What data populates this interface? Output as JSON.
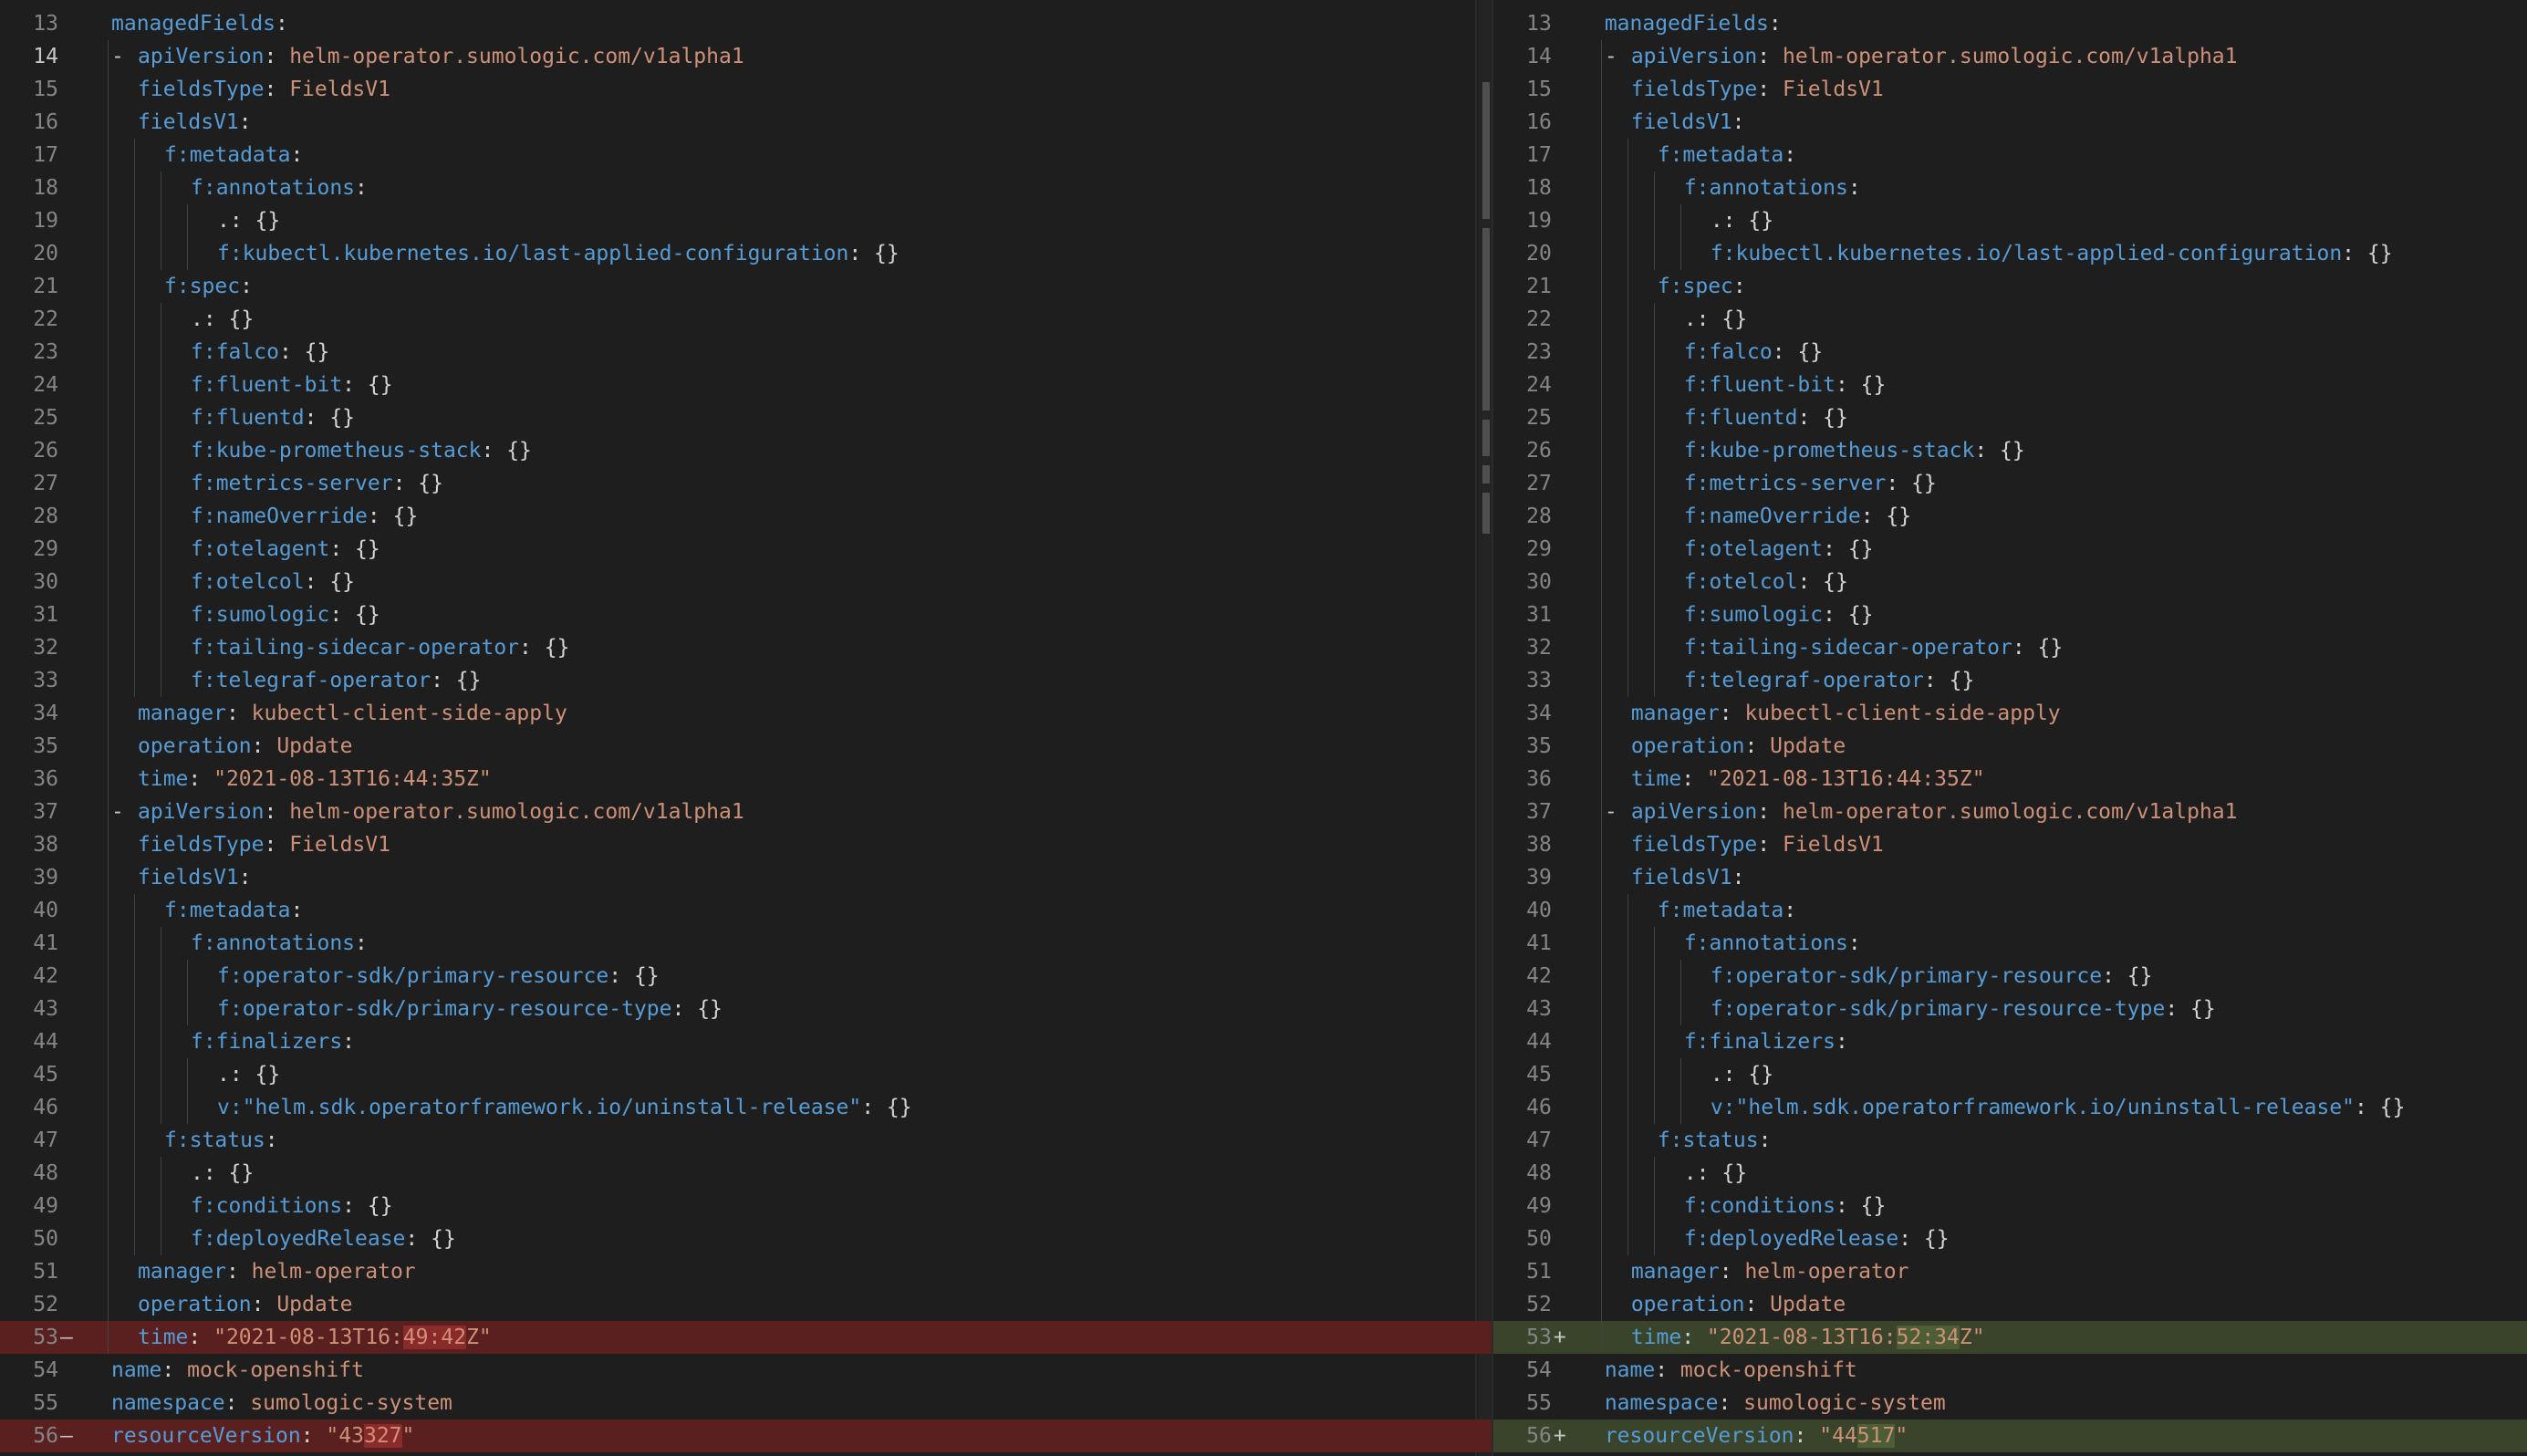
{
  "colors": {
    "removed_bg": "#5a1f1f",
    "added_bg": "#39442a",
    "key": "#569cd6",
    "string": "#ce9178"
  },
  "left": {
    "lines": [
      {
        "n": "13",
        "m": "",
        "fold": "",
        "indent": 0,
        "k": "managedFields",
        "sep": ":",
        "v": ""
      },
      {
        "n": "14",
        "m": "",
        "fold": "-",
        "indent": 1,
        "k": "apiVersion",
        "sep": ": ",
        "v": "helm-operator.sumologic.com/v1alpha1",
        "cur": true
      },
      {
        "n": "15",
        "m": "",
        "fold": "",
        "indent": 1,
        "k": "fieldsType",
        "sep": ": ",
        "v": "FieldsV1"
      },
      {
        "n": "16",
        "m": "",
        "fold": "",
        "indent": 1,
        "k": "fieldsV1",
        "sep": ":",
        "v": ""
      },
      {
        "n": "17",
        "m": "",
        "fold": "",
        "indent": 2,
        "k": "f:metadata",
        "sep": ":",
        "v": ""
      },
      {
        "n": "18",
        "m": "",
        "fold": "",
        "indent": 3,
        "k": "f:annotations",
        "sep": ":",
        "v": ""
      },
      {
        "n": "19",
        "m": "",
        "fold": "",
        "indent": 4,
        "k": "",
        "sep": ".: {}",
        "v": ""
      },
      {
        "n": "20",
        "m": "",
        "fold": "",
        "indent": 4,
        "k": "f:kubectl.kubernetes.io/last-applied-configuration",
        "sep": ": {}",
        "v": ""
      },
      {
        "n": "21",
        "m": "",
        "fold": "",
        "indent": 2,
        "k": "f:spec",
        "sep": ":",
        "v": ""
      },
      {
        "n": "22",
        "m": "",
        "fold": "",
        "indent": 3,
        "k": "",
        "sep": ".: {}",
        "v": ""
      },
      {
        "n": "23",
        "m": "",
        "fold": "",
        "indent": 3,
        "k": "f:falco",
        "sep": ": {}",
        "v": ""
      },
      {
        "n": "24",
        "m": "",
        "fold": "",
        "indent": 3,
        "k": "f:fluent-bit",
        "sep": ": {}",
        "v": ""
      },
      {
        "n": "25",
        "m": "",
        "fold": "",
        "indent": 3,
        "k": "f:fluentd",
        "sep": ": {}",
        "v": ""
      },
      {
        "n": "26",
        "m": "",
        "fold": "",
        "indent": 3,
        "k": "f:kube-prometheus-stack",
        "sep": ": {}",
        "v": ""
      },
      {
        "n": "27",
        "m": "",
        "fold": "",
        "indent": 3,
        "k": "f:metrics-server",
        "sep": ": {}",
        "v": ""
      },
      {
        "n": "28",
        "m": "",
        "fold": "",
        "indent": 3,
        "k": "f:nameOverride",
        "sep": ": {}",
        "v": ""
      },
      {
        "n": "29",
        "m": "",
        "fold": "",
        "indent": 3,
        "k": "f:otelagent",
        "sep": ": {}",
        "v": ""
      },
      {
        "n": "30",
        "m": "",
        "fold": "",
        "indent": 3,
        "k": "f:otelcol",
        "sep": ": {}",
        "v": ""
      },
      {
        "n": "31",
        "m": "",
        "fold": "",
        "indent": 3,
        "k": "f:sumologic",
        "sep": ": {}",
        "v": ""
      },
      {
        "n": "32",
        "m": "",
        "fold": "",
        "indent": 3,
        "k": "f:tailing-sidecar-operator",
        "sep": ": {}",
        "v": ""
      },
      {
        "n": "33",
        "m": "",
        "fold": "",
        "indent": 3,
        "k": "f:telegraf-operator",
        "sep": ": {}",
        "v": ""
      },
      {
        "n": "34",
        "m": "",
        "fold": "",
        "indent": 1,
        "k": "manager",
        "sep": ": ",
        "v": "kubectl-client-side-apply"
      },
      {
        "n": "35",
        "m": "",
        "fold": "",
        "indent": 1,
        "k": "operation",
        "sep": ": ",
        "v": "Update"
      },
      {
        "n": "36",
        "m": "",
        "fold": "",
        "indent": 1,
        "k": "time",
        "sep": ": ",
        "v": "\"2021-08-13T16:44:35Z\""
      },
      {
        "n": "37",
        "m": "",
        "fold": "-",
        "indent": 1,
        "k": "apiVersion",
        "sep": ": ",
        "v": "helm-operator.sumologic.com/v1alpha1"
      },
      {
        "n": "38",
        "m": "",
        "fold": "",
        "indent": 1,
        "k": "fieldsType",
        "sep": ": ",
        "v": "FieldsV1"
      },
      {
        "n": "39",
        "m": "",
        "fold": "",
        "indent": 1,
        "k": "fieldsV1",
        "sep": ":",
        "v": ""
      },
      {
        "n": "40",
        "m": "",
        "fold": "",
        "indent": 2,
        "k": "f:metadata",
        "sep": ":",
        "v": ""
      },
      {
        "n": "41",
        "m": "",
        "fold": "",
        "indent": 3,
        "k": "f:annotations",
        "sep": ":",
        "v": ""
      },
      {
        "n": "42",
        "m": "",
        "fold": "",
        "indent": 4,
        "k": "f:operator-sdk/primary-resource",
        "sep": ": {}",
        "v": ""
      },
      {
        "n": "43",
        "m": "",
        "fold": "",
        "indent": 4,
        "k": "f:operator-sdk/primary-resource-type",
        "sep": ": {}",
        "v": ""
      },
      {
        "n": "44",
        "m": "",
        "fold": "",
        "indent": 3,
        "k": "f:finalizers",
        "sep": ":",
        "v": ""
      },
      {
        "n": "45",
        "m": "",
        "fold": "",
        "indent": 4,
        "k": "",
        "sep": ".: {}",
        "v": ""
      },
      {
        "n": "46",
        "m": "",
        "fold": "",
        "indent": 4,
        "k": "v:\"helm.sdk.operatorframework.io/uninstall-release\"",
        "sep": ": {}",
        "v": ""
      },
      {
        "n": "47",
        "m": "",
        "fold": "",
        "indent": 2,
        "k": "f:status",
        "sep": ":",
        "v": ""
      },
      {
        "n": "48",
        "m": "",
        "fold": "",
        "indent": 3,
        "k": "",
        "sep": ".: {}",
        "v": ""
      },
      {
        "n": "49",
        "m": "",
        "fold": "",
        "indent": 3,
        "k": "f:conditions",
        "sep": ": {}",
        "v": ""
      },
      {
        "n": "50",
        "m": "",
        "fold": "",
        "indent": 3,
        "k": "f:deployedRelease",
        "sep": ": {}",
        "v": ""
      },
      {
        "n": "51",
        "m": "",
        "fold": "",
        "indent": 1,
        "k": "manager",
        "sep": ": ",
        "v": "helm-operator"
      },
      {
        "n": "52",
        "m": "",
        "fold": "",
        "indent": 1,
        "k": "operation",
        "sep": ": ",
        "v": "Update"
      },
      {
        "n": "53",
        "m": "—",
        "fold": "",
        "indent": 1,
        "k": "time",
        "sep": ": ",
        "v": "\"2021-08-13T16:",
        "vh": "49:42",
        "v2": "Z\"",
        "type": "removed"
      },
      {
        "n": "54",
        "m": "",
        "fold": "",
        "indent": 0,
        "k": "name",
        "sep": ": ",
        "v": "mock-openshift"
      },
      {
        "n": "55",
        "m": "",
        "fold": "",
        "indent": 0,
        "k": "namespace",
        "sep": ": ",
        "v": "sumologic-system"
      },
      {
        "n": "56",
        "m": "—",
        "fold": "",
        "indent": 0,
        "k": "resourceVersion",
        "sep": ": ",
        "v": "\"43",
        "vh": "327",
        "v2": "\"",
        "type": "removed"
      }
    ]
  },
  "right": {
    "lines": [
      {
        "n": "13",
        "m": "",
        "fold": "",
        "indent": 0,
        "k": "managedFields",
        "sep": ":",
        "v": ""
      },
      {
        "n": "14",
        "m": "",
        "fold": "-",
        "indent": 1,
        "k": "apiVersion",
        "sep": ": ",
        "v": "helm-operator.sumologic.com/v1alpha1"
      },
      {
        "n": "15",
        "m": "",
        "fold": "",
        "indent": 1,
        "k": "fieldsType",
        "sep": ": ",
        "v": "FieldsV1"
      },
      {
        "n": "16",
        "m": "",
        "fold": "",
        "indent": 1,
        "k": "fieldsV1",
        "sep": ":",
        "v": ""
      },
      {
        "n": "17",
        "m": "",
        "fold": "",
        "indent": 2,
        "k": "f:metadata",
        "sep": ":",
        "v": ""
      },
      {
        "n": "18",
        "m": "",
        "fold": "",
        "indent": 3,
        "k": "f:annotations",
        "sep": ":",
        "v": ""
      },
      {
        "n": "19",
        "m": "",
        "fold": "",
        "indent": 4,
        "k": "",
        "sep": ".: {}",
        "v": ""
      },
      {
        "n": "20",
        "m": "",
        "fold": "",
        "indent": 4,
        "k": "f:kubectl.kubernetes.io/last-applied-configuration",
        "sep": ": {}",
        "v": ""
      },
      {
        "n": "21",
        "m": "",
        "fold": "",
        "indent": 2,
        "k": "f:spec",
        "sep": ":",
        "v": ""
      },
      {
        "n": "22",
        "m": "",
        "fold": "",
        "indent": 3,
        "k": "",
        "sep": ".: {}",
        "v": ""
      },
      {
        "n": "23",
        "m": "",
        "fold": "",
        "indent": 3,
        "k": "f:falco",
        "sep": ": {}",
        "v": ""
      },
      {
        "n": "24",
        "m": "",
        "fold": "",
        "indent": 3,
        "k": "f:fluent-bit",
        "sep": ": {}",
        "v": ""
      },
      {
        "n": "25",
        "m": "",
        "fold": "",
        "indent": 3,
        "k": "f:fluentd",
        "sep": ": {}",
        "v": ""
      },
      {
        "n": "26",
        "m": "",
        "fold": "",
        "indent": 3,
        "k": "f:kube-prometheus-stack",
        "sep": ": {}",
        "v": ""
      },
      {
        "n": "27",
        "m": "",
        "fold": "",
        "indent": 3,
        "k": "f:metrics-server",
        "sep": ": {}",
        "v": ""
      },
      {
        "n": "28",
        "m": "",
        "fold": "",
        "indent": 3,
        "k": "f:nameOverride",
        "sep": ": {}",
        "v": ""
      },
      {
        "n": "29",
        "m": "",
        "fold": "",
        "indent": 3,
        "k": "f:otelagent",
        "sep": ": {}",
        "v": ""
      },
      {
        "n": "30",
        "m": "",
        "fold": "",
        "indent": 3,
        "k": "f:otelcol",
        "sep": ": {}",
        "v": ""
      },
      {
        "n": "31",
        "m": "",
        "fold": "",
        "indent": 3,
        "k": "f:sumologic",
        "sep": ": {}",
        "v": ""
      },
      {
        "n": "32",
        "m": "",
        "fold": "",
        "indent": 3,
        "k": "f:tailing-sidecar-operator",
        "sep": ": {}",
        "v": ""
      },
      {
        "n": "33",
        "m": "",
        "fold": "",
        "indent": 3,
        "k": "f:telegraf-operator",
        "sep": ": {}",
        "v": ""
      },
      {
        "n": "34",
        "m": "",
        "fold": "",
        "indent": 1,
        "k": "manager",
        "sep": ": ",
        "v": "kubectl-client-side-apply"
      },
      {
        "n": "35",
        "m": "",
        "fold": "",
        "indent": 1,
        "k": "operation",
        "sep": ": ",
        "v": "Update"
      },
      {
        "n": "36",
        "m": "",
        "fold": "",
        "indent": 1,
        "k": "time",
        "sep": ": ",
        "v": "\"2021-08-13T16:44:35Z\""
      },
      {
        "n": "37",
        "m": "",
        "fold": "-",
        "indent": 1,
        "k": "apiVersion",
        "sep": ": ",
        "v": "helm-operator.sumologic.com/v1alpha1"
      },
      {
        "n": "38",
        "m": "",
        "fold": "",
        "indent": 1,
        "k": "fieldsType",
        "sep": ": ",
        "v": "FieldsV1"
      },
      {
        "n": "39",
        "m": "",
        "fold": "",
        "indent": 1,
        "k": "fieldsV1",
        "sep": ":",
        "v": ""
      },
      {
        "n": "40",
        "m": "",
        "fold": "",
        "indent": 2,
        "k": "f:metadata",
        "sep": ":",
        "v": ""
      },
      {
        "n": "41",
        "m": "",
        "fold": "",
        "indent": 3,
        "k": "f:annotations",
        "sep": ":",
        "v": ""
      },
      {
        "n": "42",
        "m": "",
        "fold": "",
        "indent": 4,
        "k": "f:operator-sdk/primary-resource",
        "sep": ": {}",
        "v": ""
      },
      {
        "n": "43",
        "m": "",
        "fold": "",
        "indent": 4,
        "k": "f:operator-sdk/primary-resource-type",
        "sep": ": {}",
        "v": ""
      },
      {
        "n": "44",
        "m": "",
        "fold": "",
        "indent": 3,
        "k": "f:finalizers",
        "sep": ":",
        "v": ""
      },
      {
        "n": "45",
        "m": "",
        "fold": "",
        "indent": 4,
        "k": "",
        "sep": ".: {}",
        "v": ""
      },
      {
        "n": "46",
        "m": "",
        "fold": "",
        "indent": 4,
        "k": "v:\"helm.sdk.operatorframework.io/uninstall-release\"",
        "sep": ": {}",
        "v": ""
      },
      {
        "n": "47",
        "m": "",
        "fold": "",
        "indent": 2,
        "k": "f:status",
        "sep": ":",
        "v": ""
      },
      {
        "n": "48",
        "m": "",
        "fold": "",
        "indent": 3,
        "k": "",
        "sep": ".: {}",
        "v": ""
      },
      {
        "n": "49",
        "m": "",
        "fold": "",
        "indent": 3,
        "k": "f:conditions",
        "sep": ": {}",
        "v": ""
      },
      {
        "n": "50",
        "m": "",
        "fold": "",
        "indent": 3,
        "k": "f:deployedRelease",
        "sep": ": {}",
        "v": ""
      },
      {
        "n": "51",
        "m": "",
        "fold": "",
        "indent": 1,
        "k": "manager",
        "sep": ": ",
        "v": "helm-operator"
      },
      {
        "n": "52",
        "m": "",
        "fold": "",
        "indent": 1,
        "k": "operation",
        "sep": ": ",
        "v": "Update"
      },
      {
        "n": "53",
        "m": "+",
        "fold": "",
        "indent": 1,
        "k": "time",
        "sep": ": ",
        "v": "\"2021-08-13T16:",
        "vh": "52:34",
        "v2": "Z\"",
        "type": "added"
      },
      {
        "n": "54",
        "m": "",
        "fold": "",
        "indent": 0,
        "k": "name",
        "sep": ": ",
        "v": "mock-openshift"
      },
      {
        "n": "55",
        "m": "",
        "fold": "",
        "indent": 0,
        "k": "namespace",
        "sep": ": ",
        "v": "sumologic-system"
      },
      {
        "n": "56",
        "m": "+",
        "fold": "",
        "indent": 0,
        "k": "resourceVersion",
        "sep": ": ",
        "v": "\"44",
        "vh": "517",
        "v2": "\"",
        "type": "added"
      }
    ]
  }
}
